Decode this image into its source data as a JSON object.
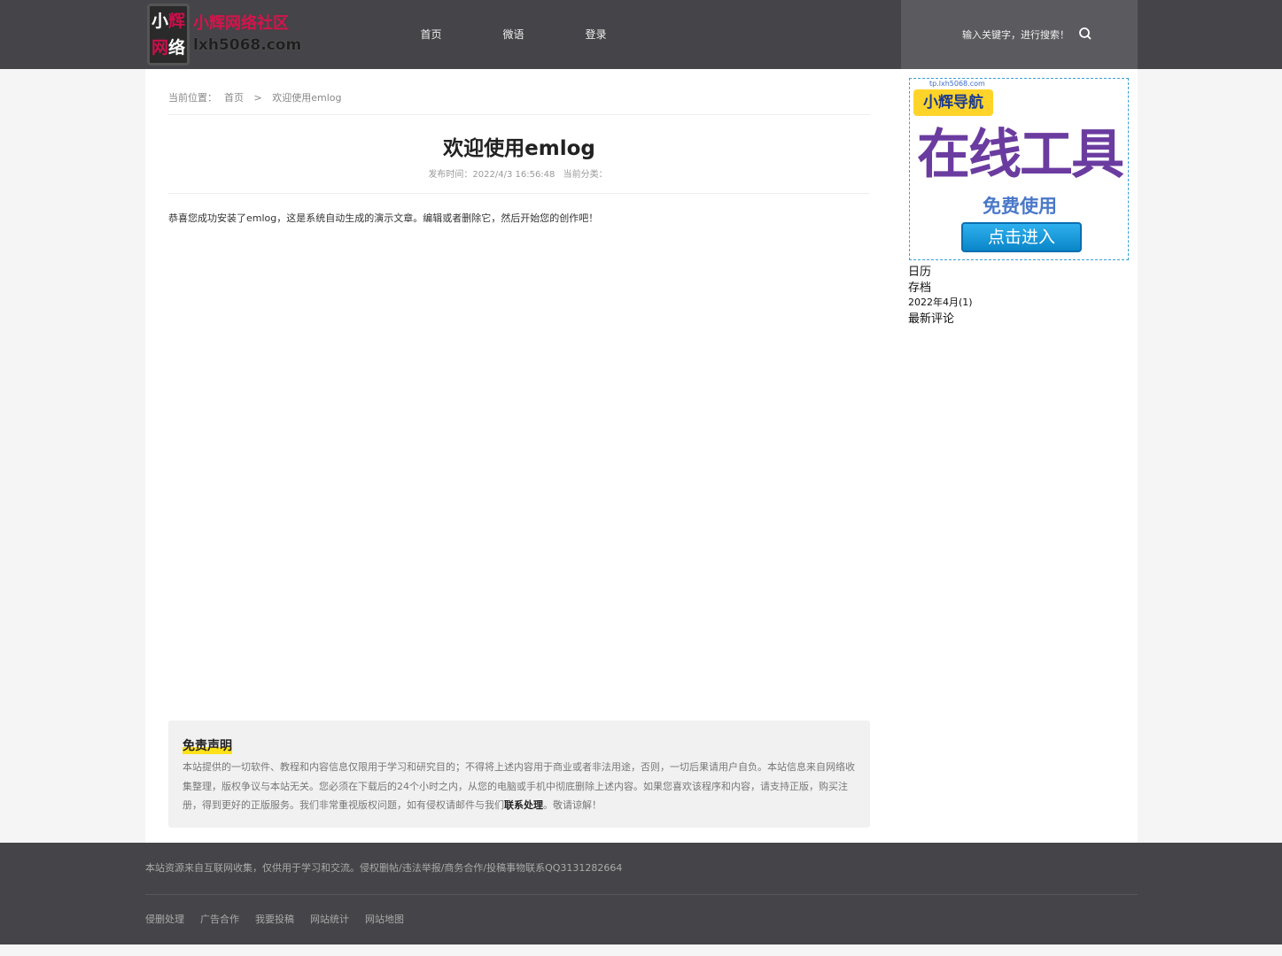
{
  "header": {
    "logo": {
      "chars": [
        "小",
        "辉",
        "网",
        "络"
      ],
      "site_name": "小辉网络社区",
      "domain": "lxh5068.com"
    },
    "nav": [
      "首页",
      "微语",
      "登录"
    ],
    "search_placeholder": "输入关键字，进行搜索！",
    "search_icon": "search-icon"
  },
  "breadcrumb": {
    "prefix": "当前位置：",
    "home": "首页",
    "separator": ">",
    "current": "欢迎使用emlog"
  },
  "post": {
    "title": "欢迎使用emlog",
    "date_label": "发布时间：",
    "date": "2022/4/3 16:56:48",
    "category_label": "当前分类："
  },
  "post_body": "恭喜您成功安装了emlog，这是系统自动生成的演示文章。编辑或者删除它，然后开始您的创作吧！",
  "disclaimer": {
    "title": "免责声明",
    "text": "本站提供的一切软件、教程和内容信息仅限用于学习和研究目的；不得将上述内容用于商业或者非法用途，否则，一切后果请用户自负。本站信息来自网络收集整理，版权争议与本站无关。您必须在下载后的24个小时之内，从您的电脑或手机中彻底删除上述内容。如果您喜欢该程序和内容，请支持正版，购买注册，得到更好的正版服务。我们非常重视版权问题，如有侵权请邮件与我们",
    "link": "联系处理",
    "tail": "。敬请谅解！"
  },
  "ad": {
    "url": "tp.lxh5068.com",
    "badge": "小辉导航",
    "headline": "在线工具",
    "sub": "免费使用",
    "button": "点击进入"
  },
  "sidebar": {
    "calendar": "日历",
    "archive": "存档",
    "archive_item": "2022年4月(1)",
    "comments": "最新评论"
  },
  "footer": {
    "note": "本站资源来自互联网收集，仅供用于学习和交流。侵权删帖/违法举报/商务合作/投稿事物联系QQ3131282664",
    "links": [
      "侵删处理",
      "广告合作",
      "我要投稿",
      "网站统计",
      "网站地图"
    ]
  }
}
